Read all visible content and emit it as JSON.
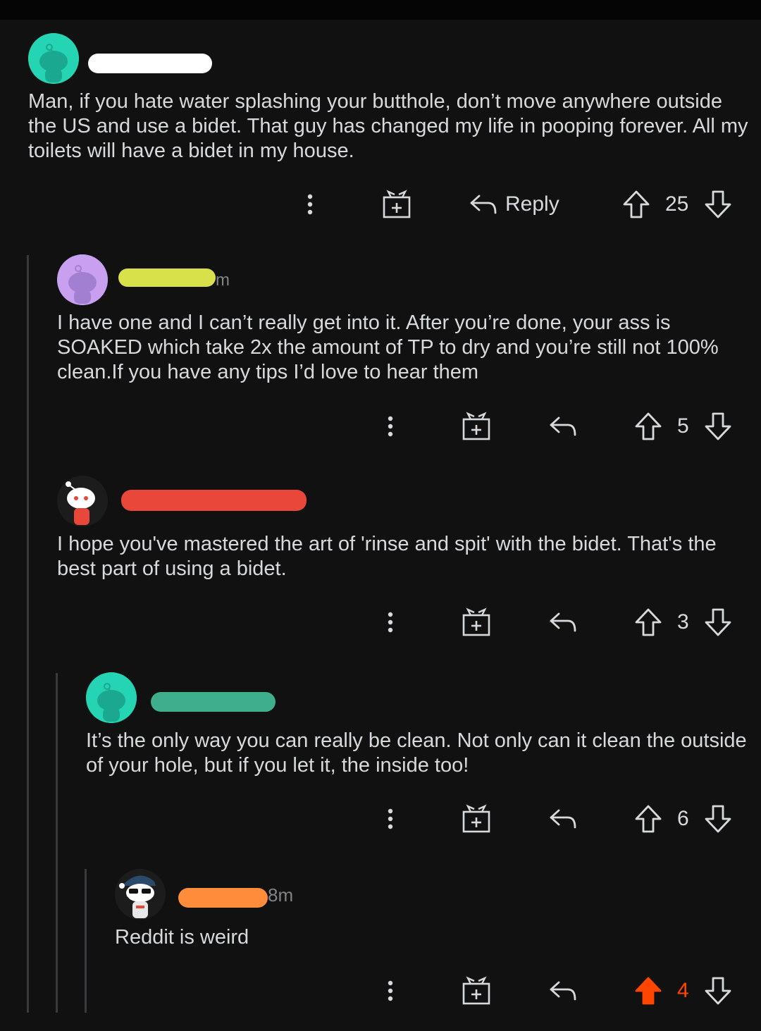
{
  "comments": [
    {
      "text": "Man, if you hate water splashing your butthole, don’t move anywhere outside the US and use a bidet. That guy has changed my life in pooping forever. All my toilets will have a bidet in my house.",
      "age": "",
      "reply_label": "Reply",
      "score": "25",
      "avatar_color": "#24d4b3",
      "redaction_color": "#ffffff"
    },
    {
      "text": "I have one and I can’t really get into it. After you’re done, your ass is SOAKED which take 2x the amount of TP to dry and you’re still not 100% clean.If you have any tips I’d love to hear them",
      "age": "m",
      "score": "5",
      "avatar_color": "#c9a0f0",
      "redaction_color": "#d8e04a"
    },
    {
      "text": "I hope you've mastered the art of 'rinse and spit' with the bidet. That's the best part of using a bidet.",
      "age": "",
      "score": "3",
      "avatar_color": "#1c1c1c",
      "redaction_color": "#e8473a"
    },
    {
      "text": "It’s the only way you can really be clean. Not only can it clean the outside of your hole, but if you let it, the inside too!",
      "age": "",
      "score": "6",
      "avatar_color": "#24d4b3",
      "redaction_color": "#3fae8c"
    },
    {
      "text": "Reddit is weird",
      "age": "8m",
      "score": "4",
      "upvoted": true,
      "avatar_color": "#1c1c1c",
      "redaction_color": "#ff8c3a"
    }
  ],
  "colors": {
    "background": "#111111",
    "upvote_active": "#ff4500",
    "thread_line": "#3a3a3c"
  },
  "icons": [
    "more-options-icon",
    "gift-award-icon",
    "reply-arrow-icon",
    "upvote-arrow-icon",
    "downvote-arrow-icon"
  ]
}
